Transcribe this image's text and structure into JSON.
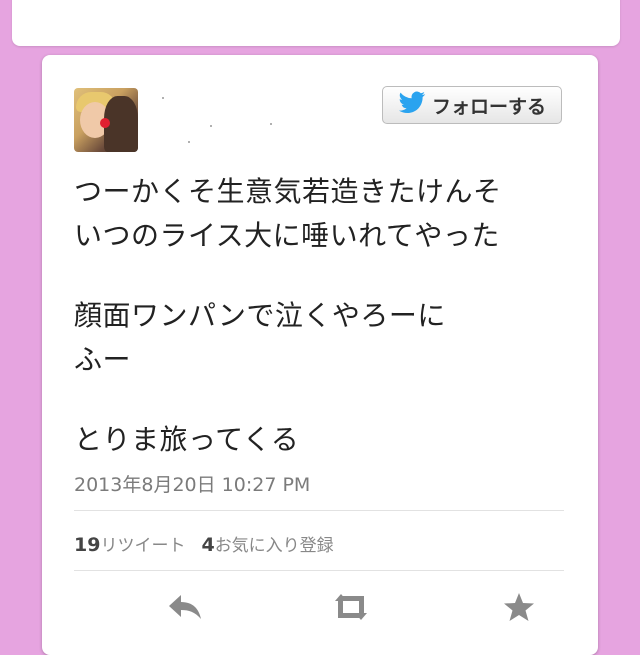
{
  "follow_button": {
    "label": "フォローする",
    "icon": "twitter-bird-icon"
  },
  "tweet": {
    "lines_p1": [
      "つーかくそ生意気若造きたけんそ",
      "いつのライス大に唾いれてやった"
    ],
    "lines_p2": [
      "顔面ワンパンで泣くやろーに",
      "ふー"
    ],
    "lines_p3": [
      "とりま旅ってくる"
    ]
  },
  "timestamp": "2013年8月20日 10:27 PM",
  "stats": {
    "retweet_count": "19",
    "retweet_label": "リツイート",
    "favorite_count": "4",
    "favorite_label": "お気に入り登録"
  },
  "actions": [
    "reply-icon",
    "retweet-icon",
    "favorite-star-icon"
  ],
  "colors": {
    "background": "#e6a4e0",
    "card": "#ffffff",
    "twitter_blue": "#2aa3ef"
  }
}
